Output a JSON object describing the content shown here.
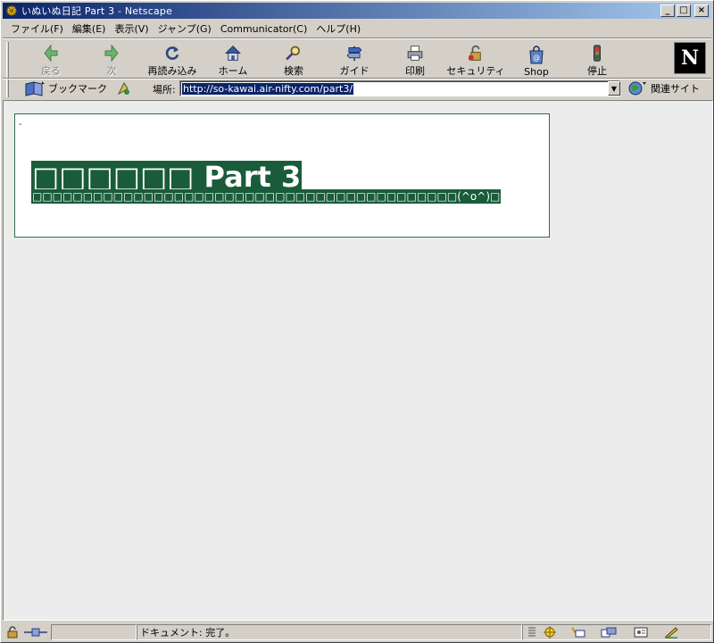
{
  "window": {
    "title": "いぬいぬ日記 Part 3 - Netscape",
    "controls": {
      "minimize": "_",
      "maximize": "□",
      "close": "×"
    }
  },
  "menu": [
    "ファイル(F)",
    "編集(E)",
    "表示(V)",
    "ジャンプ(G)",
    "Communicator(C)",
    "ヘルプ(H)"
  ],
  "toolbar": {
    "back": "戻る",
    "forward": "次",
    "reload": "再読み込み",
    "home": "ホーム",
    "search": "検索",
    "guide": "ガイド",
    "print": "印刷",
    "security": "セキュリティ",
    "shop": "Shop",
    "stop": "停止",
    "logo": "N"
  },
  "location": {
    "bookmarks_label": "ブックマーク",
    "label": "場所:",
    "url": "http://so-kawai.air-nifty.com/part3/",
    "related_label": "関連サイト"
  },
  "page": {
    "dash": "-",
    "heading": "□□□□□□ Part 3",
    "subline": "□□□□□□□□□□□□□□□□□□□□□□□□□□□□□□□□□□□□□□□□□□(^o^)□"
  },
  "status": {
    "text": "ドキュメント: 完了。"
  },
  "colors": {
    "title_bar_start": "#0a246a",
    "title_bar_end": "#a6caf0",
    "heading_bg": "#1a5c3a",
    "page_border": "#2e6e4e",
    "content_bg": "#ececec",
    "chrome": "#d4d0c8"
  }
}
